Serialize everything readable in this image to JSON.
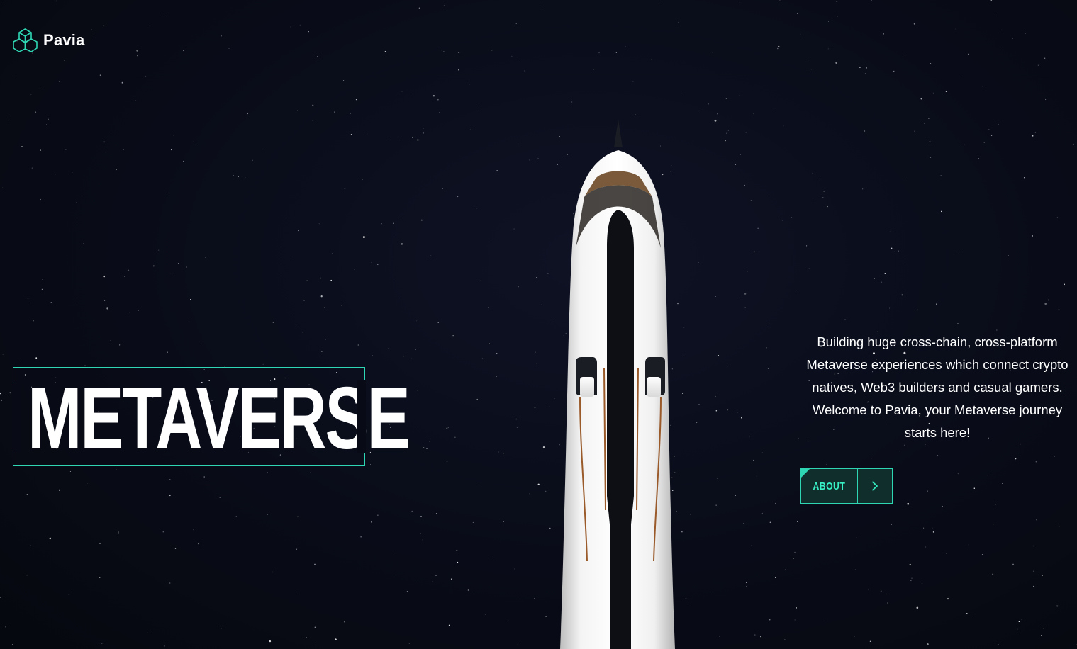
{
  "header": {
    "brand": "Pavia",
    "logo_icon": "cube-network-icon"
  },
  "hero": {
    "title": "METAVERSE",
    "description": "Building huge cross-chain, cross-platform Metaverse experiences which connect crypto natives, Web3 builders and casual gamers. Welcome to Pavia, your Metaverse journey starts here!",
    "about_button": {
      "label": "ABOUT",
      "icon": "chevron-right-icon"
    },
    "background_image": "rocket-in-starfield"
  },
  "colors": {
    "accent": "#2fd6b3",
    "accent_text": "#37f0c5",
    "background": "#080b16",
    "text": "#ffffff"
  }
}
